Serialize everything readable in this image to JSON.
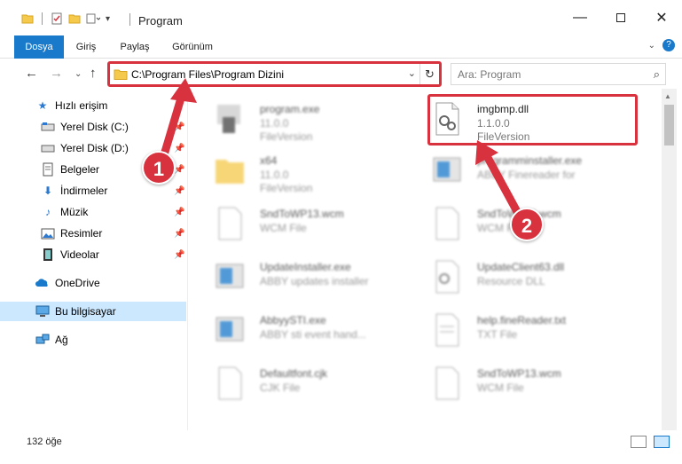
{
  "window": {
    "title": "Program"
  },
  "ribbon": {
    "tabs": [
      "Dosya",
      "Giriş",
      "Paylaş",
      "Görünüm"
    ]
  },
  "address": {
    "path": "C:\\Program Files\\Program Dizini"
  },
  "search": {
    "placeholder": "Ara: Program"
  },
  "sidebar": {
    "items": [
      {
        "label": "Hızlı erişim",
        "icon": "star-icon"
      },
      {
        "label": "Yerel Disk (C:)",
        "icon": "drive-icon"
      },
      {
        "label": "Yerel Disk (D:)",
        "icon": "drive-icon"
      },
      {
        "label": "Belgeler",
        "icon": "documents-icon"
      },
      {
        "label": "İndirmeler",
        "icon": "download-icon"
      },
      {
        "label": "Müzik",
        "icon": "music-icon"
      },
      {
        "label": "Resimler",
        "icon": "pictures-icon"
      },
      {
        "label": "Videolar",
        "icon": "video-icon"
      },
      {
        "label": "OneDrive",
        "icon": "cloud-icon"
      },
      {
        "label": "Bu bilgisayar",
        "icon": "computer-icon"
      },
      {
        "label": "Ağ",
        "icon": "network-icon"
      }
    ]
  },
  "files": [
    {
      "name": "program.exe",
      "line2": "11.0.0",
      "line3": "FileVersion"
    },
    {
      "name": "imgbmp.dll",
      "line2": "1.1.0.0",
      "line3": "FileVersion"
    },
    {
      "name": "x64",
      "line2": "11.0.0",
      "line3": "FileVersion"
    },
    {
      "name": "programminstaller.exe",
      "line2": "ABBY Finereader for",
      "line3": ""
    },
    {
      "name": "SndToWP13.wcm",
      "line2": "WCM File",
      "line3": ""
    },
    {
      "name": "SndToWP13.wcm",
      "line2": "WCM File",
      "line3": ""
    },
    {
      "name": "UpdateInstaller.exe",
      "line2": "ABBY updates installer",
      "line3": ""
    },
    {
      "name": "UpdateClient63.dll",
      "line2": "Resource DLL",
      "line3": ""
    },
    {
      "name": "AbbyySTI.exe",
      "line2": "ABBY sti event hand...",
      "line3": ""
    },
    {
      "name": "help.fineReader.txt",
      "line2": "TXT File",
      "line3": ""
    },
    {
      "name": "Defaultfont.cjk",
      "line2": "CJK File",
      "line3": ""
    },
    {
      "name": "SndToWP13.wcm",
      "line2": "WCM File",
      "line3": ""
    }
  ],
  "status": {
    "count": "132 öğe"
  },
  "annotations": {
    "badge1": "1",
    "badge2": "2"
  },
  "colors": {
    "accent": "#1979ca",
    "highlight": "#d9323f",
    "selected": "#cce8ff"
  }
}
